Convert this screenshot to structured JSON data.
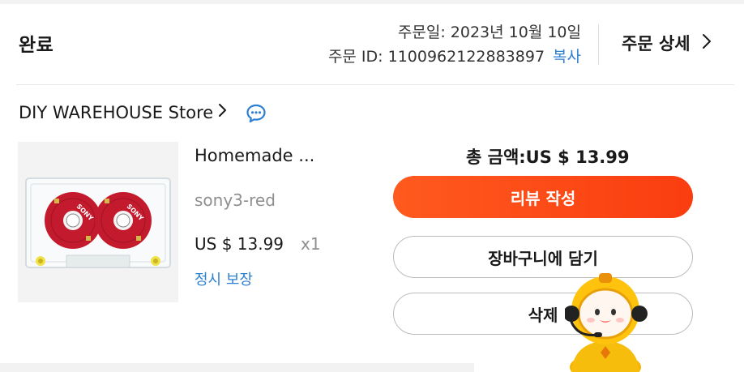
{
  "order": {
    "status": "완료",
    "date_text": "주문일: 2023년 10월 10일",
    "id_text": "주문 ID: 1100962122883897",
    "copy_label": "복사",
    "detail_label": "주문 상세"
  },
  "store": {
    "name": "DIY WAREHOUSE Store"
  },
  "item": {
    "name": "Homemade ...",
    "variant": "sony3-red",
    "price": "US $ 13.99",
    "quantity": "x1",
    "guarantee": "정시 보장",
    "reel_logo": "SONY"
  },
  "summary": {
    "total_text": "총 금액:US $ 13.99"
  },
  "actions": {
    "review_label": "리뷰 작성",
    "cart_label": "장바구니에 담기",
    "delete_label": "삭제"
  },
  "colors": {
    "accent": "#fa4b14",
    "link": "#2d7fd2",
    "reel": "#c41a2e"
  },
  "icons": {
    "detail": "chevron-right-icon",
    "store": "chevron-right-icon",
    "chat": "chat-bubble-icon",
    "mascot": "astronaut-mascot-icon"
  }
}
